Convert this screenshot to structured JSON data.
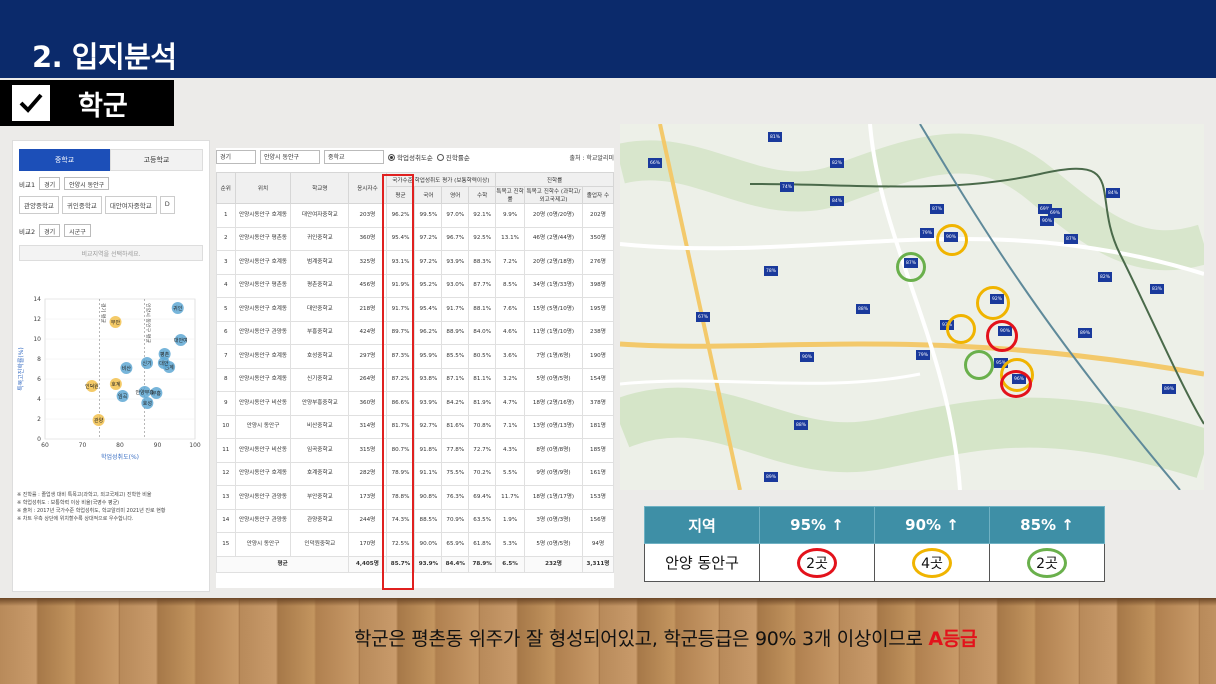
{
  "header": {
    "title": "2. 입지분석"
  },
  "section": {
    "label": "학군"
  },
  "caption": {
    "text": "학군은 평촌동 위주가 잘 형성되어있고, 학군등급은 90% 3개 이상이므로 ",
    "highlight": "A등급"
  },
  "left_panel": {
    "tab_middle": "중학교",
    "tab_high": "고등학교",
    "compare1_label": "비교1",
    "compare1_region": "경기",
    "compare1_district": "안양시 동안구",
    "schools": [
      "관양중학교",
      "귀인중학교",
      "대안여자중학교",
      "D"
    ],
    "compare2_label": "비교2",
    "compare2_region": "경기",
    "compare2_district": "시군구",
    "compare_placeholder": "비교지역을 선택하세요.",
    "notes": [
      "※ 진학률 : 졸업생 대비 특목고(과학고, 외고국제고) 진학한 비율",
      "※ 학업성취도 : 보통학력 이상 비율(국영수 평균)",
      "※ 출처 : 2017년 국가수준 학업성취도, 학교알리미 2021년 진로 현황",
      "※ 차트 우측 상단에 위치할수록 상대적으로 우수합니다."
    ]
  },
  "chart_data": {
    "type": "scatter",
    "xlabel": "학업성취도(%)",
    "ylabel": "특목고진학률(%)",
    "xlim": [
      60,
      100
    ],
    "ylim": [
      0,
      14
    ],
    "xticks": [
      60,
      70,
      80,
      90,
      100
    ],
    "yticks": [
      0,
      2,
      4,
      6,
      8,
      10,
      12,
      14
    ],
    "ref_lines": [
      {
        "x": 74.5,
        "label": "경기 평균"
      },
      {
        "x": 86.5,
        "label": "안양시 동안구 평균"
      }
    ],
    "points": [
      {
        "label": "귀인",
        "x": 95.4,
        "y": 13.1,
        "color": "#5fa8d3"
      },
      {
        "label": "부안",
        "x": 78.8,
        "y": 11.7,
        "color": "#f2c14e"
      },
      {
        "label": "대안여",
        "x": 96.2,
        "y": 9.9,
        "color": "#5fa8d3"
      },
      {
        "label": "평촌",
        "x": 91.9,
        "y": 8.5,
        "color": "#5fa8d3"
      },
      {
        "label": "신기",
        "x": 87.2,
        "y": 7.6,
        "color": "#5fa8d3"
      },
      {
        "label": "부흥",
        "x": 89.7,
        "y": 4.6,
        "color": "#5fa8d3"
      },
      {
        "label": "호성",
        "x": 87.3,
        "y": 3.6,
        "color": "#5fa8d3"
      },
      {
        "label": "범계",
        "x": 93.1,
        "y": 7.2,
        "color": "#5fa8d3"
      },
      {
        "label": "대안",
        "x": 91.7,
        "y": 7.6,
        "color": "#5fa8d3"
      },
      {
        "label": "안양부흥",
        "x": 86.6,
        "y": 4.7,
        "color": "#5fa8d3"
      },
      {
        "label": "비산",
        "x": 81.7,
        "y": 7.1,
        "color": "#5fa8d3"
      },
      {
        "label": "임곡",
        "x": 80.7,
        "y": 4.3,
        "color": "#5fa8d3"
      },
      {
        "label": "호계",
        "x": 78.9,
        "y": 5.5,
        "color": "#f2c14e"
      },
      {
        "label": "인덕원",
        "x": 72.5,
        "y": 5.3,
        "color": "#f2c14e"
      },
      {
        "label": "관양",
        "x": 74.3,
        "y": 1.9,
        "color": "#f2c14e"
      }
    ]
  },
  "table_panel": {
    "filter_region": "경기",
    "filter_district": "안양시 동안구",
    "filter_level": "중학교",
    "radio_achievement": "학업성취도순",
    "radio_admission": "진학률순",
    "source": "출처 : 학교알리미",
    "group_header_achievement": "국가수준 학업성취도 평가 (보통학력이상)",
    "group_header_admission": "진학률",
    "columns": [
      "순위",
      "위치",
      "학교명",
      "응시자수",
      "평균",
      "국어",
      "영어",
      "수학",
      "특목고 진학률",
      "특목고 진학수 (과학고/외고국제고)",
      "졸업자 수"
    ],
    "rows": [
      [
        "1",
        "안양시동안구 호계동",
        "대안여자중학교",
        "203명",
        "96.2%",
        "99.5%",
        "97.0%",
        "92.1%",
        "9.9%",
        "20명 (0명/20명)",
        "202명"
      ],
      [
        "2",
        "안양시동안구 평촌동",
        "귀인중학교",
        "360명",
        "95.4%",
        "97.2%",
        "96.7%",
        "92.5%",
        "13.1%",
        "46명 (2명/44명)",
        "350명"
      ],
      [
        "3",
        "안양시동안구 호계동",
        "범계중학교",
        "325명",
        "93.1%",
        "97.2%",
        "93.9%",
        "88.3%",
        "7.2%",
        "20명 (2명/18명)",
        "276명"
      ],
      [
        "4",
        "안양시동안구 평촌동",
        "평촌중학교",
        "456명",
        "91.9%",
        "95.2%",
        "93.0%",
        "87.7%",
        "8.5%",
        "34명 (1명/33명)",
        "398명"
      ],
      [
        "5",
        "안양시동안구 호계동",
        "대안중학교",
        "218명",
        "91.7%",
        "95.4%",
        "91.7%",
        "88.1%",
        "7.6%",
        "15명 (5명/10명)",
        "195명"
      ],
      [
        "6",
        "안양시동안구 관양동",
        "부흥중학교",
        "424명",
        "89.7%",
        "96.2%",
        "88.9%",
        "84.0%",
        "4.6%",
        "11명 (1명/10명)",
        "238명"
      ],
      [
        "7",
        "안양시동안구 호계동",
        "호성중학교",
        "297명",
        "87.3%",
        "95.9%",
        "85.5%",
        "80.5%",
        "3.6%",
        "7명 (1명/6명)",
        "190명"
      ],
      [
        "8",
        "안양시동안구 호계동",
        "신기중학교",
        "264명",
        "87.2%",
        "93.8%",
        "87.1%",
        "81.1%",
        "3.2%",
        "5명 (0명/5명)",
        "154명"
      ],
      [
        "9",
        "안양시동안구 비산동",
        "안양부흥중학교",
        "360명",
        "86.6%",
        "93.9%",
        "84.2%",
        "81.9%",
        "4.7%",
        "18명 (2명/16명)",
        "378명"
      ],
      [
        "10",
        "안양시 동안구",
        "비산중학교",
        "314명",
        "81.7%",
        "92.7%",
        "81.6%",
        "70.8%",
        "7.1%",
        "13명 (0명/13명)",
        "181명"
      ],
      [
        "11",
        "안양시동안구 비산동",
        "임곡중학교",
        "315명",
        "80.7%",
        "91.8%",
        "77.8%",
        "72.7%",
        "4.3%",
        "8명 (0명/8명)",
        "185명"
      ],
      [
        "12",
        "안양시동안구 호계동",
        "호계중학교",
        "282명",
        "78.9%",
        "91.1%",
        "75.5%",
        "70.2%",
        "5.5%",
        "9명 (0명/9명)",
        "161명"
      ],
      [
        "13",
        "안양시동안구 관양동",
        "부안중학교",
        "173명",
        "78.8%",
        "90.8%",
        "76.3%",
        "69.4%",
        "11.7%",
        "18명 (1명/17명)",
        "153명"
      ],
      [
        "14",
        "안양시동안구 관양동",
        "관양중학교",
        "244명",
        "74.3%",
        "88.5%",
        "70.9%",
        "63.5%",
        "1.9%",
        "3명 (0명/3명)",
        "156명"
      ],
      [
        "15",
        "안양시 동안구",
        "인덕원중학교",
        "170명",
        "72.5%",
        "90.0%",
        "65.9%",
        "61.8%",
        "5.3%",
        "5명 (0명/5명)",
        "94명"
      ]
    ],
    "average": [
      "평균",
      "4,405명",
      "85.7%",
      "93.9%",
      "84.4%",
      "78.9%",
      "6.5%",
      "232명",
      "3,311명"
    ]
  },
  "map": {
    "pins": [
      "66%",
      "81%",
      "82%",
      "74%",
      "84%",
      "79%",
      "87%",
      "90%",
      "93%",
      "92%",
      "90%",
      "95%",
      "96%",
      "78%",
      "67%",
      "69%",
      "69%",
      "79%",
      "90%",
      "88%",
      "83%",
      "82%",
      "84%",
      "87%",
      "89%",
      "90%",
      "89%",
      "87%",
      "88%",
      "89%"
    ]
  },
  "summary": {
    "headers": [
      "지역",
      "95% ↑",
      "90% ↑",
      "85% ↑"
    ],
    "region": "안양 동안구",
    "counts": [
      "2곳",
      "4곳",
      "2곳"
    ],
    "ring_colors": [
      "#e3121b",
      "#f0b400",
      "#6ab04c"
    ]
  }
}
